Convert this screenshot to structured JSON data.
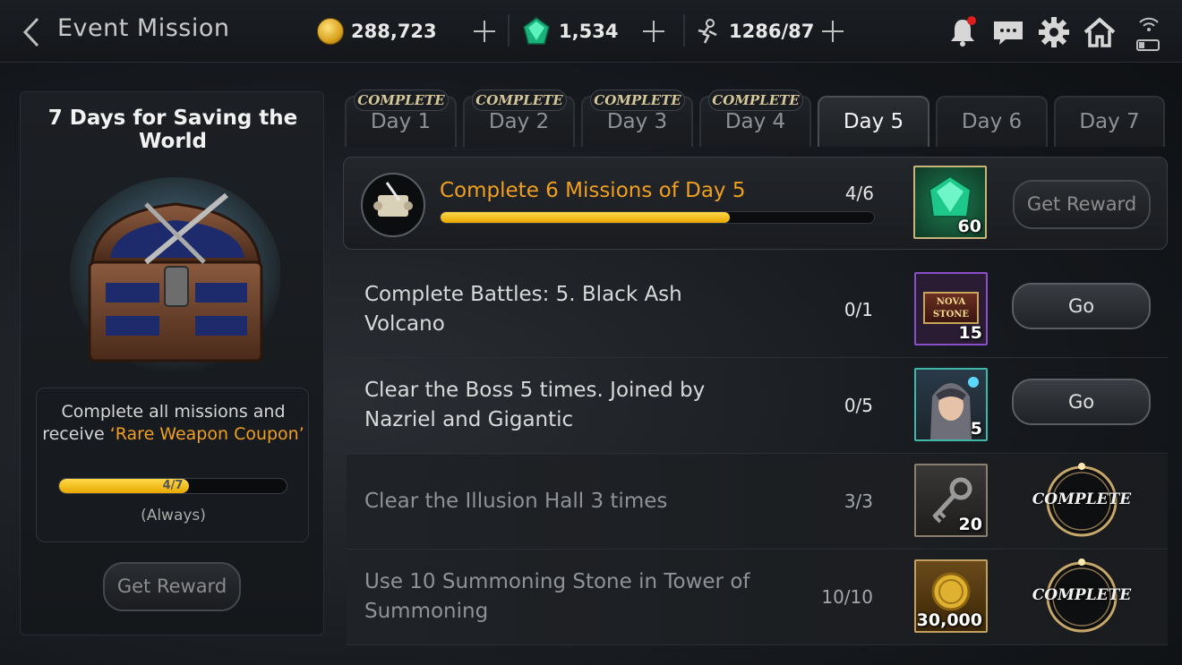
{
  "header": {
    "title": "Event Mission",
    "gold": "288,723",
    "gems": "1,534",
    "stamina": "1286/87"
  },
  "left_panel": {
    "title": "7 Days for Saving the World",
    "desc_line1": "Complete all missions and",
    "desc_line2_prefix": "receive ",
    "desc_highlight": "‘Rare Weapon Coupon’",
    "progress_text": "4/7",
    "progress_fraction": 0.571,
    "period": "(Always)",
    "reward_button": "Get Reward"
  },
  "tabs": [
    {
      "label": "Day 1",
      "badge": "COMPLETE",
      "state": "complete"
    },
    {
      "label": "Day 2",
      "badge": "COMPLETE",
      "state": "complete"
    },
    {
      "label": "Day 3",
      "badge": "COMPLETE",
      "state": "complete"
    },
    {
      "label": "Day 4",
      "badge": "COMPLETE",
      "state": "complete"
    },
    {
      "label": "Day 5",
      "badge": "",
      "state": "active"
    },
    {
      "label": "Day 6",
      "badge": "",
      "state": "locked"
    },
    {
      "label": "Day 7",
      "badge": "",
      "state": "locked"
    }
  ],
  "main_mission": {
    "text": "Complete 6 Missions of Day 5",
    "progress": "4/6",
    "progress_fraction": 0.667,
    "reward_qty": "60",
    "button": "Get Reward"
  },
  "missions": [
    {
      "line1": "Complete Battles: 5. Black Ash",
      "line2": "Volcano",
      "progress": "0/1",
      "reward_qty": "15",
      "reward_icon": "nova-stone-icon",
      "reward_label": "NOVA STONE",
      "action": "Go"
    },
    {
      "line1": "Clear the Boss 5 times. Joined by",
      "line2": "Nazriel and Gigantic",
      "progress": "0/5",
      "reward_qty": "5",
      "reward_icon": "hero-portrait-icon",
      "action": "Go"
    },
    {
      "line1": "Clear the Illusion Hall 3 times",
      "line2": "",
      "progress": "3/3",
      "reward_qty": "20",
      "reward_icon": "key-icon",
      "action": "COMPLETE"
    },
    {
      "line1": "Use 10 Summoning Stone in Tower of",
      "line2": "Summoning",
      "progress": "10/10",
      "reward_qty": "30,000",
      "reward_icon": "gold-coin-icon",
      "action": "COMPLETE"
    }
  ],
  "colors": {
    "accent_orange": "#f0a020",
    "progress_yellow": "#ffd84a",
    "gem_green": "#2ee0a0"
  }
}
